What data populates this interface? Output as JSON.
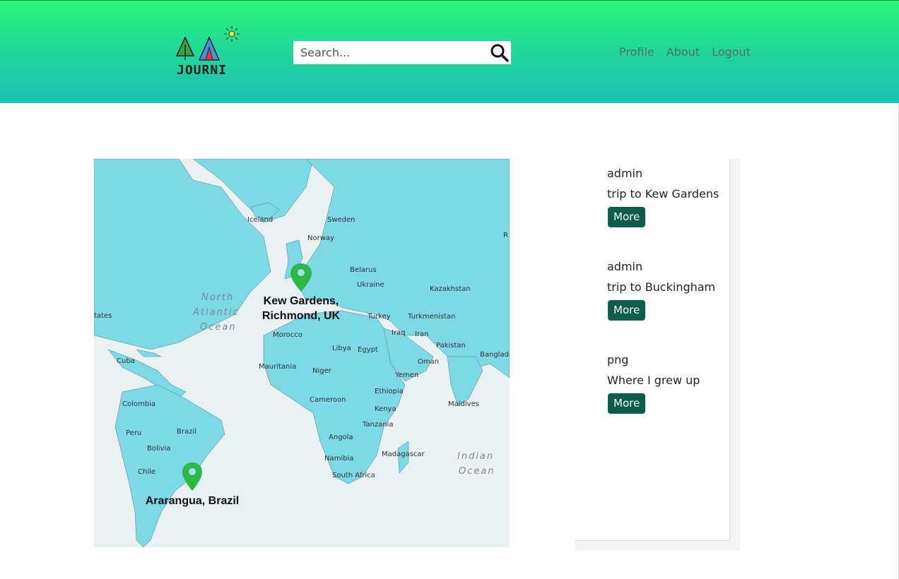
{
  "header": {
    "logo_text": "JOURNI",
    "search_placeholder": "Search...",
    "nav": [
      "Profile",
      "About",
      "Logout"
    ]
  },
  "map": {
    "pins": [
      {
        "label_line1": "Kew Gardens,",
        "label_line2": "Richmond, UK"
      },
      {
        "label_line1": "Ararangua, Brazil",
        "label_line2": ""
      }
    ],
    "countries": [
      "Iceland",
      "Sweden",
      "Norway",
      "Belarus",
      "Ukraine",
      "Kazakhstan",
      "Turkey",
      "Turkmenistan",
      "Iraq",
      "Iran",
      "Morocco",
      "Libya",
      "Egypt",
      "Pakistan",
      "Oman",
      "Bangladesh",
      "Mauritania",
      "Niger",
      "Yemen",
      "Cuba",
      "Ethiopia",
      "Cameroon",
      "Colombia",
      "Kenya",
      "Maldives",
      "Peru",
      "Brazil",
      "Tanzania",
      "Bolivia",
      "Angola",
      "Madagascar",
      "Namibia",
      "Chile",
      "South Africa",
      "tates",
      "R"
    ],
    "oceans": [
      "North",
      "Atlantic",
      "Ocean",
      "Indian",
      "Ocean"
    ],
    "colors": {
      "land": "#7dd9e6",
      "water": "#eaf1f2",
      "pin": "#2db84a"
    }
  },
  "posts": [
    {
      "user": "admin",
      "title": "trip to Kew Gardens",
      "button": "More"
    },
    {
      "user": "admin",
      "title": "trip to Buckingham",
      "button": "More"
    },
    {
      "user": "png",
      "title": "Where I grew up",
      "button": "More"
    }
  ]
}
